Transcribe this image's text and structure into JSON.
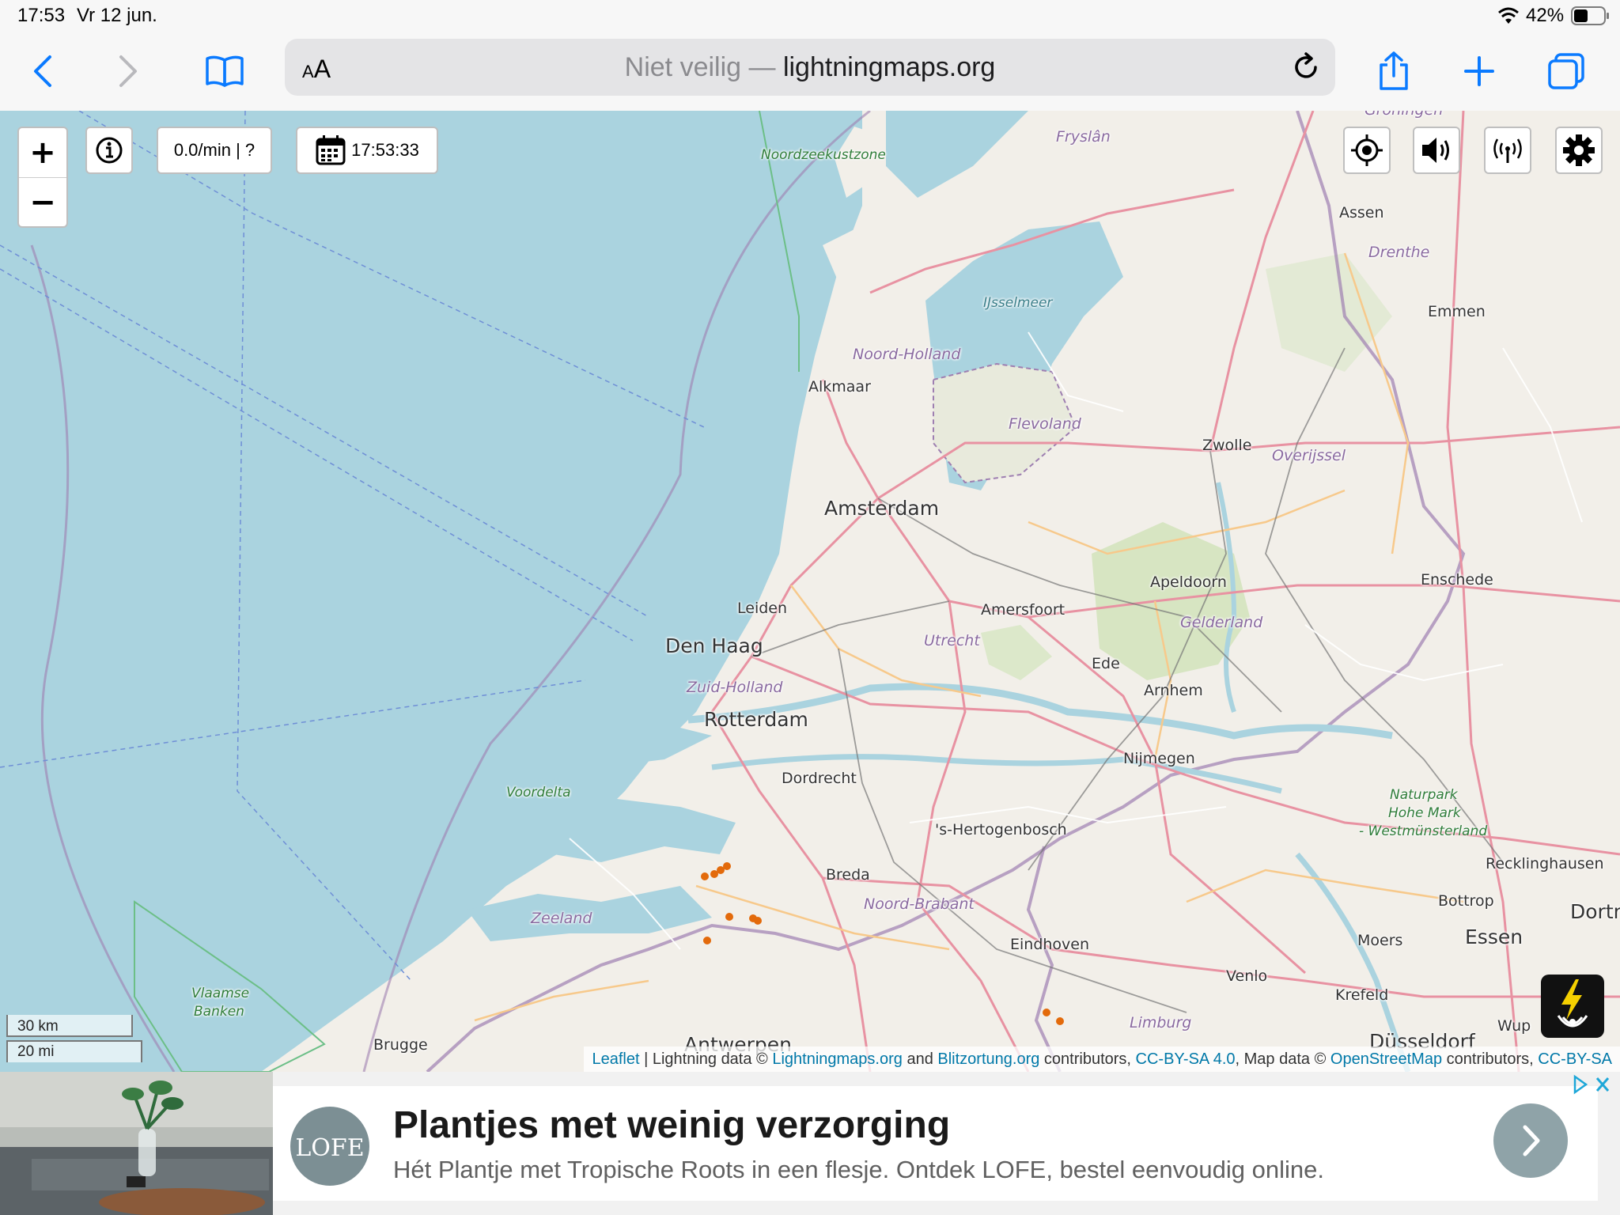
{
  "status_bar": {
    "time": "17:53",
    "date": "Vr 12 jun.",
    "battery": "42%"
  },
  "browser": {
    "text_size_label": "AA",
    "url_prefix": "Niet veilig —",
    "url_domain": "lightningmaps.org",
    "icons": [
      "back-icon",
      "forward-icon",
      "bookmarks-icon",
      "reload-icon",
      "share-icon",
      "new-tab-icon",
      "tabs-icon"
    ]
  },
  "map": {
    "controls": {
      "zoom_in": "+",
      "zoom_out": "−",
      "rate": "0.0/min | ?",
      "clock": "17:53:33",
      "icons": [
        "info-icon",
        "calendar-icon",
        "locate-icon",
        "sound-icon",
        "signal-icon",
        "settings-icon",
        "lightning-icon"
      ]
    },
    "scale": {
      "km": "30 km",
      "mi": "20 mi"
    },
    "labels": {
      "groningen": "Groningen",
      "fryslan": "Fryslân",
      "noordzeekustzone": "Noordzeekustzone",
      "assen": "Assen",
      "drenthe": "Drenthe",
      "ijsselmeer": "IJsselmeer",
      "emmen": "Emmen",
      "noord_holland": "Noord-Holland",
      "alkmaar": "Alkmaar",
      "flevoland": "Flevoland",
      "zwolle": "Zwolle",
      "overijssel": "Overijssel",
      "amsterdam": "Amsterdam",
      "apeldoorn": "Apeldoorn",
      "enschede": "Enschede",
      "leiden": "Leiden",
      "amersfoort": "Amersfoort",
      "gelderland": "Gelderland",
      "den_haag": "Den Haag",
      "utrecht": "Utrecht",
      "ede": "Ede",
      "zuid_holland": "Zuid-Holland",
      "arnhem": "Arnhem",
      "rotterdam": "Rotterdam",
      "nijmegen": "Nijmegen",
      "dordrecht": "Dordrecht",
      "voordelta": "Voordelta",
      "hohe_mark_1": "Naturpark",
      "hohe_mark_2": "Hohe Mark",
      "hohe_mark_3": "- Westmünsterland",
      "den_bosch": "'s-Hertogenbosch",
      "recklinghausen": "Recklinghausen",
      "breda": "Breda",
      "noord_brabant": "Noord-Brabant",
      "bottrop": "Bottrop",
      "dortmund": "Dortm",
      "zeeland": "Zeeland",
      "eindhoven": "Eindhoven",
      "moers": "Moers",
      "essen": "Essen",
      "venlo": "Venlo",
      "krefeld": "Krefeld",
      "vlaamse_1": "Vlaamse",
      "vlaamse_2": "Banken",
      "limburg": "Limburg",
      "wuppertal": "Wup",
      "brugge": "Brugge",
      "antwerpen": "Antwerpen",
      "dusseldorf": "Düsseldorf"
    },
    "attribution": {
      "leaflet": "Leaflet",
      "sep": " | Lightning data © ",
      "lm": "Lightningmaps.org",
      "and": " and ",
      "bo": "Blitzortung.org",
      "contrib": " contributors, ",
      "cc1": "CC-BY-SA 4.0",
      "mapdata": ", Map data © ",
      "osm": "OpenStreetMap",
      "contrib2": " contributors, ",
      "cc2": "CC-BY-SA"
    },
    "colors": {
      "sea": "#aad3df",
      "land": "#f2efe9",
      "strike": "#e36a0b",
      "border": "#9e7fb1"
    }
  },
  "ad": {
    "logo_text": "LOFE",
    "title": "Plantjes met weinig verzorging",
    "subtitle": "Hét Plantje met Tropische Roots in een flesje. Ontdek LOFE, bestel eenvoudig online."
  }
}
